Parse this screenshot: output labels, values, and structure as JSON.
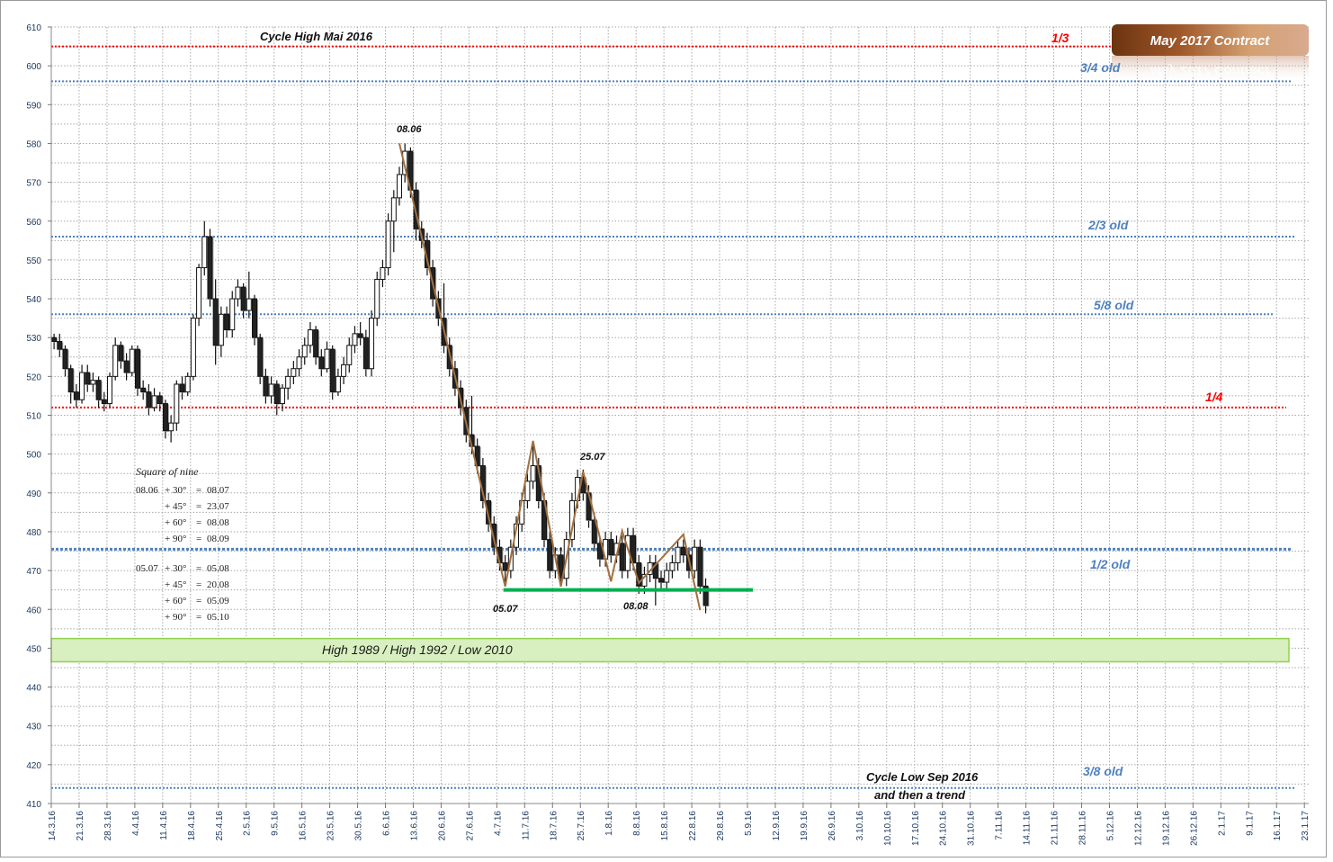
{
  "chart_data": {
    "type": "candlestick",
    "title": "May 2017 Contract",
    "ylim": [
      410,
      610
    ],
    "yticks": [
      410,
      420,
      430,
      440,
      450,
      460,
      470,
      480,
      490,
      500,
      510,
      520,
      530,
      540,
      550,
      560,
      570,
      580,
      590,
      600,
      610
    ],
    "xticks": [
      "14.3.16",
      "21.3.16",
      "28.3.16",
      "4.4.16",
      "11.4.16",
      "18.4.16",
      "25.4.16",
      "2.5.16",
      "9.5.16",
      "16.5.16",
      "23.5.16",
      "30.5.16",
      "6.6.16",
      "13.6.16",
      "20.6.16",
      "27.6.16",
      "4.7.16",
      "11.7.16",
      "18.7.16",
      "25.7.16",
      "1.8.16",
      "8.8.16",
      "15.8.16",
      "22.8.16",
      "29.8.16",
      "5.9.16",
      "12.9.16",
      "19.9.16",
      "26.9.16",
      "3.10.16",
      "10.10.16",
      "17.10.16",
      "24.10.16",
      "31.10.16",
      "7.11.16",
      "14.11.16",
      "21.11.16",
      "28.11.16",
      "5.12.16",
      "12.12.16",
      "19.12.16",
      "26.12.16",
      "2.1.17",
      "9.1.17",
      "16.1.17",
      "23.1.17"
    ],
    "grid": true,
    "candles_by_week": [
      {
        "week": "14.3.16",
        "ohlc": [
          [
            530,
            531,
            527,
            529
          ],
          [
            529,
            531,
            525,
            527
          ],
          [
            527,
            528,
            520,
            522
          ],
          [
            522,
            523,
            513,
            516
          ],
          [
            516,
            518,
            512,
            514
          ]
        ]
      },
      {
        "week": "21.3.16",
        "ohlc": [
          [
            514,
            523,
            513,
            521
          ],
          [
            521,
            523,
            516,
            518
          ],
          [
            518,
            521,
            516,
            519
          ],
          [
            519,
            520,
            512,
            514
          ],
          [
            514,
            516,
            511,
            513
          ]
        ]
      },
      {
        "week": "28.3.16",
        "ohlc": [
          [
            513,
            521,
            512,
            520
          ],
          [
            520,
            530,
            519,
            528
          ],
          [
            528,
            529,
            522,
            524
          ],
          [
            524,
            526,
            519,
            521
          ],
          [
            521,
            528,
            520,
            527
          ]
        ]
      },
      {
        "week": "4.4.16",
        "ohlc": [
          [
            527,
            528,
            515,
            517
          ],
          [
            517,
            519,
            514,
            516
          ],
          [
            516,
            518,
            510,
            512
          ],
          [
            512,
            517,
            511,
            515
          ],
          [
            515,
            516,
            511,
            513
          ]
        ]
      },
      {
        "week": "11.4.16",
        "ohlc": [
          [
            513,
            514,
            504,
            506
          ],
          [
            506,
            510,
            503,
            508
          ],
          [
            508,
            519,
            506,
            518
          ],
          [
            518,
            520,
            514,
            516
          ],
          [
            516,
            521,
            515,
            520
          ]
        ]
      },
      {
        "week": "18.4.16",
        "ohlc": [
          [
            520,
            536,
            519,
            535
          ],
          [
            535,
            549,
            533,
            548
          ],
          [
            548,
            560,
            546,
            556
          ],
          [
            556,
            558,
            538,
            540
          ],
          [
            540,
            545,
            523,
            528
          ]
        ]
      },
      {
        "week": "25.4.16",
        "ohlc": [
          [
            528,
            538,
            525,
            536
          ],
          [
            536,
            538,
            530,
            532
          ],
          [
            532,
            542,
            530,
            540
          ],
          [
            540,
            545,
            538,
            543
          ],
          [
            543,
            544,
            535,
            537
          ]
        ]
      },
      {
        "week": "2.5.16",
        "ohlc": [
          [
            537,
            547,
            535,
            540
          ],
          [
            540,
            541,
            528,
            530
          ],
          [
            530,
            531,
            518,
            520
          ],
          [
            520,
            522,
            513,
            515
          ],
          [
            515,
            520,
            513,
            518
          ]
        ]
      },
      {
        "week": "9.5.16",
        "ohlc": [
          [
            518,
            519,
            510,
            513
          ],
          [
            513,
            518,
            511,
            517
          ],
          [
            517,
            522,
            514,
            520
          ],
          [
            520,
            524,
            518,
            522
          ],
          [
            522,
            527,
            520,
            525
          ]
        ]
      },
      {
        "week": "16.5.16",
        "ohlc": [
          [
            525,
            530,
            523,
            528
          ],
          [
            528,
            534,
            526,
            532
          ],
          [
            532,
            533,
            523,
            525
          ],
          [
            525,
            527,
            520,
            522
          ],
          [
            522,
            529,
            521,
            527
          ]
        ]
      },
      {
        "week": "23.5.16",
        "ohlc": [
          [
            527,
            528,
            514,
            516
          ],
          [
            516,
            522,
            515,
            520
          ],
          [
            520,
            525,
            518,
            523
          ],
          [
            523,
            530,
            521,
            528
          ],
          [
            528,
            533,
            526,
            531
          ]
        ]
      },
      {
        "week": "30.5.16",
        "ohlc": [
          [
            531,
            534,
            528,
            530
          ],
          [
            530,
            532,
            520,
            522
          ],
          [
            522,
            537,
            520,
            535
          ],
          [
            535,
            547,
            533,
            545
          ],
          [
            545,
            550,
            543,
            548
          ]
        ]
      },
      {
        "week": "6.6.16",
        "ohlc": [
          [
            548,
            562,
            546,
            560
          ],
          [
            560,
            568,
            552,
            566
          ],
          [
            566,
            574,
            564,
            572
          ],
          [
            572,
            580,
            570,
            578
          ],
          [
            578,
            579,
            566,
            568
          ]
        ]
      },
      {
        "week": "13.6.16",
        "ohlc": [
          [
            568,
            570,
            555,
            558
          ],
          [
            558,
            560,
            553,
            555
          ],
          [
            555,
            557,
            546,
            548
          ],
          [
            548,
            550,
            538,
            540
          ],
          [
            540,
            542,
            533,
            535
          ]
        ]
      },
      {
        "week": "20.6.16",
        "ohlc": [
          [
            535,
            544,
            526,
            528
          ],
          [
            528,
            530,
            520,
            522
          ],
          [
            522,
            524,
            515,
            517
          ],
          [
            517,
            519,
            510,
            512
          ],
          [
            512,
            514,
            503,
            505
          ]
        ]
      },
      {
        "week": "27.6.16",
        "ohlc": [
          [
            505,
            515,
            500,
            502
          ],
          [
            502,
            504,
            495,
            497
          ],
          [
            497,
            499,
            486,
            488
          ],
          [
            488,
            490,
            480,
            482
          ],
          [
            482,
            484,
            474,
            476
          ]
        ]
      },
      {
        "week": "4.7.16",
        "ohlc": [
          [
            476,
            478,
            470,
            472
          ],
          [
            472,
            474,
            466,
            470
          ],
          [
            470,
            478,
            468,
            476
          ],
          [
            476,
            484,
            474,
            482
          ],
          [
            482,
            490,
            480,
            488
          ]
        ]
      },
      {
        "week": "11.7.16",
        "ohlc": [
          [
            488,
            495,
            486,
            493
          ],
          [
            493,
            503,
            491,
            497
          ],
          [
            497,
            499,
            486,
            488
          ],
          [
            488,
            490,
            476,
            478
          ],
          [
            478,
            480,
            468,
            470
          ]
        ]
      },
      {
        "week": "18.7.16",
        "ohlc": [
          [
            470,
            476,
            468,
            474
          ],
          [
            474,
            476,
            466,
            468
          ],
          [
            468,
            480,
            466,
            478
          ],
          [
            478,
            490,
            476,
            488
          ],
          [
            488,
            496,
            486,
            494
          ]
        ]
      },
      {
        "week": "25.7.16",
        "ohlc": [
          [
            494,
            496,
            488,
            490
          ],
          [
            490,
            492,
            481,
            483
          ],
          [
            483,
            485,
            475,
            477
          ],
          [
            477,
            479,
            471,
            473
          ],
          [
            473,
            480,
            471,
            478
          ]
        ]
      },
      {
        "week": "1.8.16",
        "ohlc": [
          [
            478,
            480,
            472,
            474
          ],
          [
            474,
            479,
            472,
            477
          ],
          [
            477,
            479,
            468,
            470
          ],
          [
            470,
            481,
            468,
            479
          ],
          [
            479,
            481,
            470,
            472
          ]
        ]
      },
      {
        "week": "8.8.16",
        "ohlc": [
          [
            472,
            474,
            464,
            466
          ],
          [
            466,
            471,
            464,
            469
          ],
          [
            469,
            474,
            467,
            472
          ],
          [
            472,
            474,
            461,
            468
          ],
          [
            468,
            470,
            465,
            467
          ]
        ]
      },
      {
        "week": "15.8.16",
        "ohlc": [
          [
            467,
            472,
            465,
            470
          ],
          [
            470,
            474,
            468,
            472
          ],
          [
            472,
            478,
            470,
            476
          ],
          [
            476,
            478,
            472,
            474
          ],
          [
            474,
            476,
            468,
            470
          ]
        ]
      },
      {
        "week": "22.8.16",
        "ohlc": [
          [
            470,
            478,
            468,
            476
          ],
          [
            476,
            478,
            464,
            466
          ],
          [
            466,
            468,
            459,
            461
          ]
        ]
      }
    ],
    "levels": [
      {
        "label": "1/3",
        "value": 605,
        "color": "#ff0000",
        "style": "dotted"
      },
      {
        "label": "3/4 old",
        "value": 596,
        "color": "#4f81bd",
        "style": "dotted"
      },
      {
        "label": "2/3 old",
        "value": 556,
        "color": "#4f81bd",
        "style": "dotted"
      },
      {
        "label": "5/8 old",
        "value": 536,
        "color": "#4f81bd",
        "style": "dotted"
      },
      {
        "label": "1/4",
        "value": 512,
        "color": "#ff0000",
        "style": "dotted"
      },
      {
        "label": "1/2 old",
        "value": 475.5,
        "color": "#4f81bd",
        "style": "dotted-thick"
      },
      {
        "label": "3/8 old",
        "value": 414,
        "color": "#4f81bd",
        "style": "dotted"
      }
    ],
    "support_line": {
      "from": "5.7.16",
      "to": "29.8.16",
      "value": 465,
      "color": "#00b050"
    },
    "zone": {
      "label": "High 1989 / High 1992 / Low 2010",
      "range": [
        446.5,
        452.5
      ],
      "fill": "#d8efc0",
      "border": "#92d050"
    },
    "zigzag": {
      "color": "#a07040",
      "points": [
        {
          "date": "8.6.16",
          "value": 580
        },
        {
          "date": "5.7.16",
          "value": 465.9
        },
        {
          "date": "12.7.16",
          "value": 503.4
        },
        {
          "date": "19.7.16",
          "value": 465.9
        },
        {
          "date": "25.7.16",
          "value": 495.5
        },
        {
          "date": "1.8.16",
          "value": 467.2
        },
        {
          "date": "3.8.16",
          "value": 480.2
        },
        {
          "date": "8.8.16",
          "value": 466.8
        },
        {
          "date": "18.8.16",
          "value": 479.3
        },
        {
          "date": "23.8.16",
          "value": 459.8
        }
      ]
    },
    "annotations": {
      "cycle_high": "Cycle High Mai 2016",
      "peak": "08.06",
      "low1": "05.07",
      "peak2": "25.07",
      "low2": "08.08",
      "cycle_low_1": "Cycle Low Sep 2016",
      "cycle_low_2": "and then a trend"
    },
    "square_of_nine": {
      "title": "Square of nine",
      "groups": [
        {
          "start": "08.06",
          "rows": [
            {
              "op": "+ 30°",
              "eq": "=",
              "result": "08.07",
              "color": "#ff0000"
            },
            {
              "op": "+ 45°",
              "eq": "=",
              "result": "23.07",
              "color": "#ff0000"
            },
            {
              "op": "+ 60°",
              "eq": "=",
              "result": "08.08",
              "color": "#ff0000"
            },
            {
              "op": "+ 90°",
              "eq": "=",
              "result": "08.09",
              "color": "#222222"
            }
          ]
        },
        {
          "start": "05.07",
          "rows": [
            {
              "op": "+ 30°",
              "eq": "=",
              "result": "05.08",
              "color": "#222222"
            },
            {
              "op": "+ 45°",
              "eq": "=",
              "result": "20.08",
              "color": "#222222"
            },
            {
              "op": "+ 60°",
              "eq": "=",
              "result": "05.09",
              "color": "#222222"
            },
            {
              "op": "+ 90°",
              "eq": "=",
              "result": "05.10",
              "color": "#222222"
            }
          ]
        }
      ]
    },
    "colors": {
      "up": "#ffffff",
      "down": "#222222",
      "badge_from": "#6b3410",
      "badge_to": "#d4a070"
    }
  }
}
